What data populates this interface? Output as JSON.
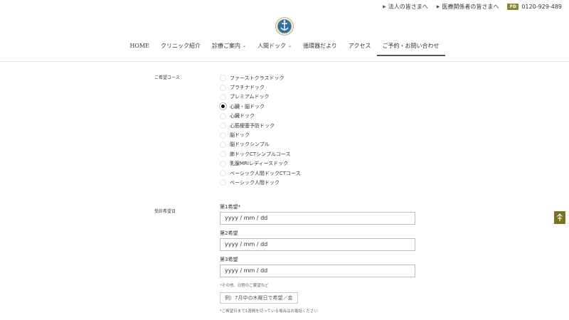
{
  "topbar": {
    "corporate_link": "法人の皆さまへ",
    "medical_link": "医療関係者の皆さまへ",
    "freedial_badge": "FD",
    "phone": "0120-929-489"
  },
  "nav": {
    "items": [
      {
        "label": "HOME",
        "has_dropdown": false,
        "active": false
      },
      {
        "label": "クリニック紹介",
        "has_dropdown": false,
        "active": false
      },
      {
        "label": "診療ご案内",
        "has_dropdown": true,
        "active": false
      },
      {
        "label": "人間ドック",
        "has_dropdown": true,
        "active": false
      },
      {
        "label": "循環器だより",
        "has_dropdown": false,
        "active": false
      },
      {
        "label": "アクセス",
        "has_dropdown": false,
        "active": false
      },
      {
        "label": "ご予約・お問い合わせ",
        "has_dropdown": false,
        "active": true
      }
    ],
    "chevron": "⌄"
  },
  "form": {
    "course_label": "ご希望コース",
    "courses": [
      {
        "label": "ファーストクラスドック",
        "checked": false
      },
      {
        "label": "プラチナドック",
        "checked": false
      },
      {
        "label": "プレミアムドック",
        "checked": false
      },
      {
        "label": "心臓・脳ドック",
        "checked": true
      },
      {
        "label": "心臓ドック",
        "checked": false
      },
      {
        "label": "心筋梗塞予防ドック",
        "checked": false
      },
      {
        "label": "脳ドック",
        "checked": false
      },
      {
        "label": "脳ドックシンプル",
        "checked": false
      },
      {
        "label": "肺ドックCTシンプルコース",
        "checked": false
      },
      {
        "label": "乳腺MRIレディースドック",
        "checked": false
      },
      {
        "label": "ベーシック人間ドックCTコース",
        "checked": false
      },
      {
        "label": "ベーシック人間ドック",
        "checked": false
      }
    ],
    "date_label": "受診希望日",
    "pref1_label": "第1希望*",
    "pref2_label": "第2希望",
    "pref3_label": "第3希望",
    "date_placeholder": "yyyy / mm / dd",
    "other_note": "*その他、日程のご要望など",
    "other_placeholder": "例）7月中の木曜日で希望／金",
    "deadline_note": "*ご希望日まで1週間を切っている場合はお電話ください"
  },
  "colors": {
    "accent": "#7c7322",
    "text": "#333333",
    "border": "#bdbdbd"
  }
}
